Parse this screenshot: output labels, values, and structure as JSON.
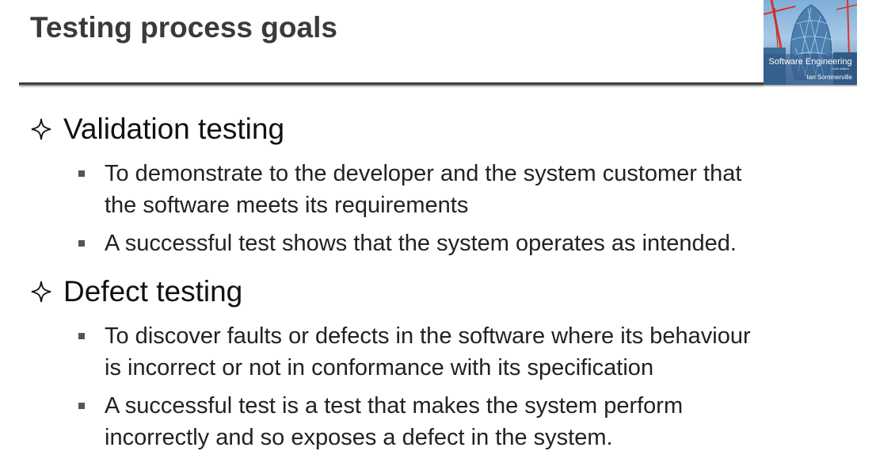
{
  "slide": {
    "title": "Testing process goals",
    "cover": {
      "title": "Software Engineering",
      "subtitle": "ninth edition",
      "author": "Ian Sommerville"
    },
    "sections": [
      {
        "heading": "Validation testing",
        "bullets": [
          {
            "lines": [
              "To demonstrate to the developer and the system customer that",
              "the software meets its requirements"
            ]
          },
          {
            "lines": [
              "A successful test shows that the system operates as intended."
            ]
          }
        ]
      },
      {
        "heading": "Defect testing",
        "bullets": [
          {
            "lines": [
              "To discover faults or defects in the software where its behaviour",
              "is incorrect or not in conformance with its specification"
            ]
          },
          {
            "lines": [
              "A successful test is a test that makes the system perform",
              "incorrectly and so exposes a defect in the system."
            ]
          }
        ]
      }
    ]
  },
  "colors": {
    "title": "#3a3a3a",
    "body": "#111111",
    "bullet_square": "#555555",
    "cover_sky": "#7eaed8"
  },
  "icons": {
    "section_marker": "four-point-star-outline-icon",
    "bullet_marker": "square-bullet-icon",
    "cover_image": "gherkin-tower-book-cover"
  }
}
